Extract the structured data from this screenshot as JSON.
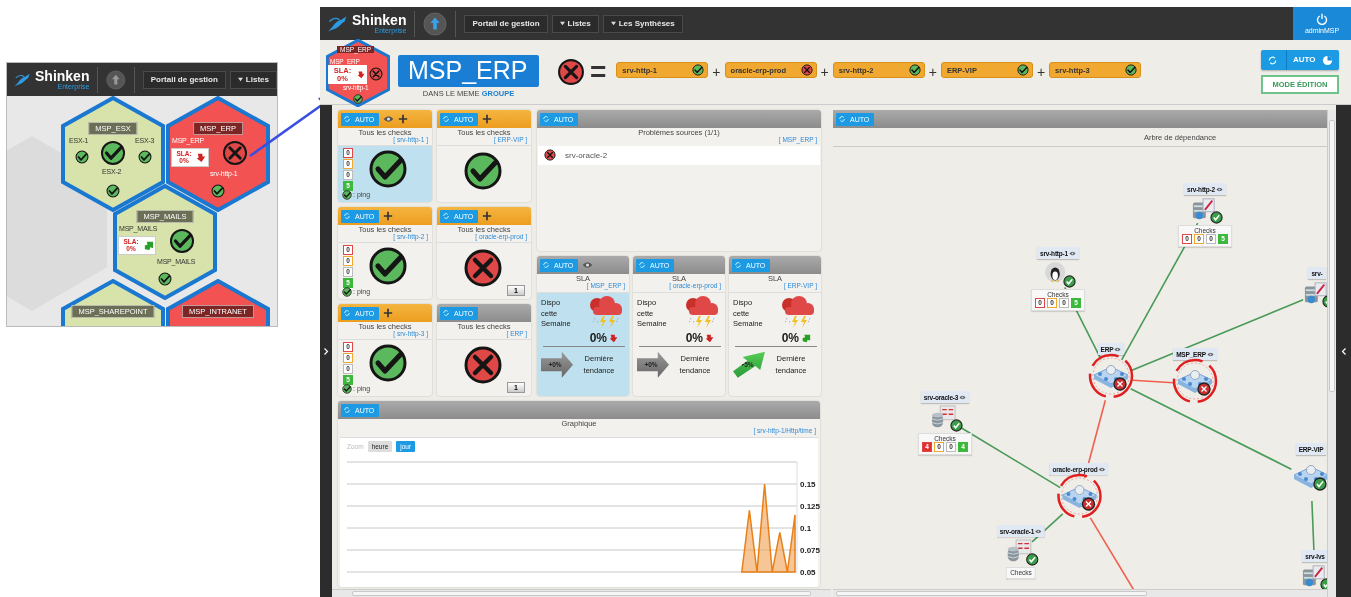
{
  "inset": {
    "logo": {
      "name": "Shinken",
      "edition": "Enterprise"
    },
    "nav": [
      {
        "label": "Portail de gestion",
        "dropdown": false
      },
      {
        "label": "Listes",
        "dropdown": true
      }
    ],
    "hexes": [
      {
        "title": "MSP_ESX",
        "failed": false,
        "kind": "cluster",
        "members": [
          "ESX-1",
          "ESX-3",
          "ESX-2"
        ],
        "member_failed": false
      },
      {
        "title": "MSP_ERP",
        "failed": true,
        "kind": "sla",
        "source": "MSP_ERP",
        "sla": "SLA: 0%",
        "trend_up": false,
        "member": "srv-http-1",
        "member_failed": false
      },
      {
        "title": "MSP_MAILS",
        "failed": false,
        "kind": "sla",
        "source": "MSP_MAILS",
        "sla": "SLA: 0%",
        "trend_up": true,
        "member": "MSP_MAILS",
        "member_failed": false
      },
      {
        "title": "MSP_SHAREPOINT",
        "failed": false,
        "kind": "partial"
      },
      {
        "title": "MSP_INTRANET",
        "failed": true,
        "kind": "partial"
      }
    ]
  },
  "main": {
    "logo": {
      "name": "Shinken",
      "edition": "Enterprise"
    },
    "nav": [
      {
        "label": "Portail de gestion",
        "dropdown": false
      },
      {
        "label": "Listes",
        "dropdown": true
      },
      {
        "label": "Les Synthèses",
        "dropdown": true
      }
    ],
    "user": "adminMSP",
    "thumbnail": {
      "title": "MSP_ERP",
      "failed": true,
      "source": "MSP_ERP",
      "sla": "SLA: 0%",
      "trend_up": false,
      "member": "srv-http-1",
      "member_failed": false
    },
    "title": "MSP_ERP",
    "subtitle": "DANS LE MEME **GROUPE**",
    "formula": {
      "failed": true,
      "equals": "=",
      "terms": [
        {
          "name": "srv-http-1",
          "failed": false
        },
        {
          "op": "+",
          "name": "oracle-erp-prod",
          "failed": true
        },
        {
          "op": "+",
          "name": "srv-http-2",
          "failed": false
        },
        {
          "op": "+",
          "name": "ERP-VIP",
          "failed": false
        },
        {
          "op": "+",
          "name": "srv-http-3",
          "failed": false
        }
      ]
    },
    "auto_button": "AUTO",
    "edit_button": "MODE ÉDITION",
    "widgets": [
      {
        "kind": "counters",
        "accent": true,
        "auto": "AUTO",
        "eye": true,
        "plus": true,
        "highlighted": true,
        "title": "Tous les checks",
        "target": "[ srv-http-1 ]",
        "failed": false,
        "counters": [
          {
            "value": "0",
            "kind": "critical",
            "filled": false
          },
          {
            "value": "0",
            "kind": "warning",
            "filled": false
          },
          {
            "value": "0",
            "kind": "unknown",
            "filled": false
          },
          {
            "value": "5",
            "kind": "ok",
            "filled": true
          }
        ],
        "probe": ": ping",
        "probe_failed": false
      },
      {
        "kind": "single",
        "accent": true,
        "auto": "AUTO",
        "eye": false,
        "plus": true,
        "highlighted": false,
        "title": "Tous les checks",
        "target": "[ ERP-VIP ]",
        "failed": false
      },
      {
        "kind": "counters",
        "accent": true,
        "auto": "AUTO",
        "eye": false,
        "plus": true,
        "highlighted": false,
        "title": "Tous les checks",
        "target": "[ srv-http-2 ]",
        "failed": false,
        "counters": [
          {
            "value": "0",
            "kind": "critical",
            "filled": false
          },
          {
            "value": "0",
            "kind": "warning",
            "filled": false
          },
          {
            "value": "0",
            "kind": "unknown",
            "filled": false
          },
          {
            "value": "5",
            "kind": "ok",
            "filled": true
          }
        ],
        "probe": ": ping",
        "probe_failed": false
      },
      {
        "kind": "single",
        "accent": true,
        "auto": "AUTO",
        "eye": false,
        "plus": true,
        "highlighted": false,
        "title": "Tous les checks",
        "target": "[ oracle-erp-prod ]",
        "failed": true,
        "badge": "1"
      },
      {
        "kind": "counters",
        "accent": true,
        "auto": "AUTO",
        "eye": false,
        "plus": true,
        "highlighted": false,
        "title": "Tous les checks",
        "target": "[ srv-http-3 ]",
        "failed": false,
        "counters": [
          {
            "value": "0",
            "kind": "critical",
            "filled": false
          },
          {
            "value": "0",
            "kind": "warning",
            "filled": false
          },
          {
            "value": "0",
            "kind": "unknown",
            "filled": false
          },
          {
            "value": "5",
            "kind": "ok",
            "filled": true
          }
        ],
        "probe": ": ping",
        "probe_failed": false
      },
      {
        "kind": "single",
        "accent": false,
        "auto": "AUTO",
        "eye": false,
        "plus": false,
        "highlighted": false,
        "title": "Tous les checks",
        "target": "[ ERP ]",
        "failed": true,
        "badge": "1"
      }
    ],
    "problems": {
      "auto": "AUTO",
      "title": "Problèmes sources (1/1)",
      "target": "[ MSP_ERP ]",
      "items": [
        {
          "name": "srv-oracle-2",
          "failed": true
        }
      ]
    },
    "sla": [
      {
        "auto": "AUTO",
        "eye": true,
        "highlighted": true,
        "title": "SLA",
        "target": "[ MSP_ERP ]",
        "label": "Dispo cette Semaine",
        "value": "0%",
        "trend_up": false,
        "delta": "+0%",
        "delta_up": false,
        "trend_label": "Dernière tendance"
      },
      {
        "auto": "AUTO",
        "eye": false,
        "highlighted": false,
        "title": "SLA",
        "target": "[ oracle-erp-prod ]",
        "label": "Dispo cette Semaine",
        "value": "0%",
        "trend_up": false,
        "delta": "+0%",
        "delta_up": false,
        "trend_label": "Dernière tendance"
      },
      {
        "auto": "AUTO",
        "eye": false,
        "highlighted": false,
        "title": "SLA",
        "target": "[ ERP-VIP ]",
        "label": "Dispo cette Semaine",
        "value": "0%",
        "trend_up": true,
        "delta": "+5%",
        "delta_up": true,
        "trend_label": "Dernière tendance"
      }
    ],
    "graph": {
      "auto": "AUTO",
      "title": "Graphique",
      "target": "[ srv-http-1/Http/time ]",
      "zoom_label": "Zoom",
      "zoom_options": [
        {
          "label": "heure",
          "selected": false
        },
        {
          "label": "jour",
          "selected": true
        }
      ],
      "chart_data": {
        "type": "area",
        "ylim": [
          0.05,
          0.175
        ],
        "yticks": [
          0.05,
          0.075,
          0.1,
          0.125,
          0.15
        ],
        "grid": true,
        "values": [
          null,
          null,
          null,
          null,
          null,
          null,
          null,
          null,
          null,
          null,
          null,
          null,
          null,
          null,
          null,
          null,
          null,
          null,
          null,
          null,
          null,
          null,
          null,
          null,
          null,
          null,
          null,
          null,
          null,
          null,
          null,
          null,
          null,
          null,
          null,
          null,
          null,
          null,
          null,
          null,
          null,
          null,
          null,
          null,
          null,
          null,
          null,
          null,
          null,
          null,
          null,
          null,
          0.05,
          0.12,
          0.05,
          0.15,
          0.05,
          0.095,
          0.05,
          0.115
        ]
      }
    },
    "tree": {
      "auto": "AUTO",
      "title": "Arbre de dépendance",
      "nodes": [
        {
          "label": "srv-http-2",
          "kind": "host",
          "failed": false,
          "eye": true,
          "checks": {
            "title": "Checks",
            "counters": [
              {
                "value": "0",
                "kind": "critical",
                "filled": false
              },
              {
                "value": "0",
                "kind": "warning",
                "filled": false
              },
              {
                "value": "0",
                "kind": "unknown",
                "filled": false
              },
              {
                "value": "5",
                "kind": "ok",
                "filled": true
              }
            ]
          }
        },
        {
          "label": "srv-http-1",
          "kind": "host",
          "failed": false,
          "eye": true,
          "checks": {
            "title": "Checks",
            "counters": [
              {
                "value": "0",
                "kind": "critical",
                "filled": false
              },
              {
                "value": "0",
                "kind": "warning",
                "filled": false
              },
              {
                "value": "0",
                "kind": "unknown",
                "filled": false
              },
              {
                "value": "5",
                "kind": "ok",
                "filled": true
              }
            ]
          }
        },
        {
          "label": "srv-",
          "kind": "host",
          "failed": false,
          "eye": false
        },
        {
          "label": "ERP",
          "kind": "group",
          "failed": true,
          "eye": true
        },
        {
          "label": "MSP_ERP",
          "kind": "group",
          "failed": true,
          "eye": true
        },
        {
          "label": "srv-oracle-3",
          "kind": "host",
          "failed": false,
          "eye": true,
          "checks": {
            "title": "Checks",
            "counters": [
              {
                "value": "4",
                "kind": "critical",
                "filled": true
              },
              {
                "value": "0",
                "kind": "warning",
                "filled": false
              },
              {
                "value": "0",
                "kind": "unknown",
                "filled": false
              },
              {
                "value": "4",
                "kind": "ok",
                "filled": true
              }
            ]
          }
        },
        {
          "label": "oracle-erp-prod",
          "kind": "group",
          "failed": true,
          "eye": true
        },
        {
          "label": "ERP-VIP",
          "kind": "group",
          "failed": false,
          "eye": false
        },
        {
          "label": "srv-oracle-1",
          "kind": "host",
          "failed": false,
          "eye": true,
          "checks": {
            "title": "Checks"
          }
        },
        {
          "label": "srv-lvs",
          "kind": "host",
          "failed": false,
          "eye": false
        }
      ],
      "links": [
        {
          "failed": false
        },
        {
          "failed": false
        },
        {
          "failed": false
        },
        {
          "failed": true
        },
        {
          "failed": false
        },
        {
          "failed": true
        },
        {
          "failed": false
        },
        {
          "failed": false
        },
        {
          "failed": true
        },
        {
          "failed": false
        }
      ]
    }
  }
}
